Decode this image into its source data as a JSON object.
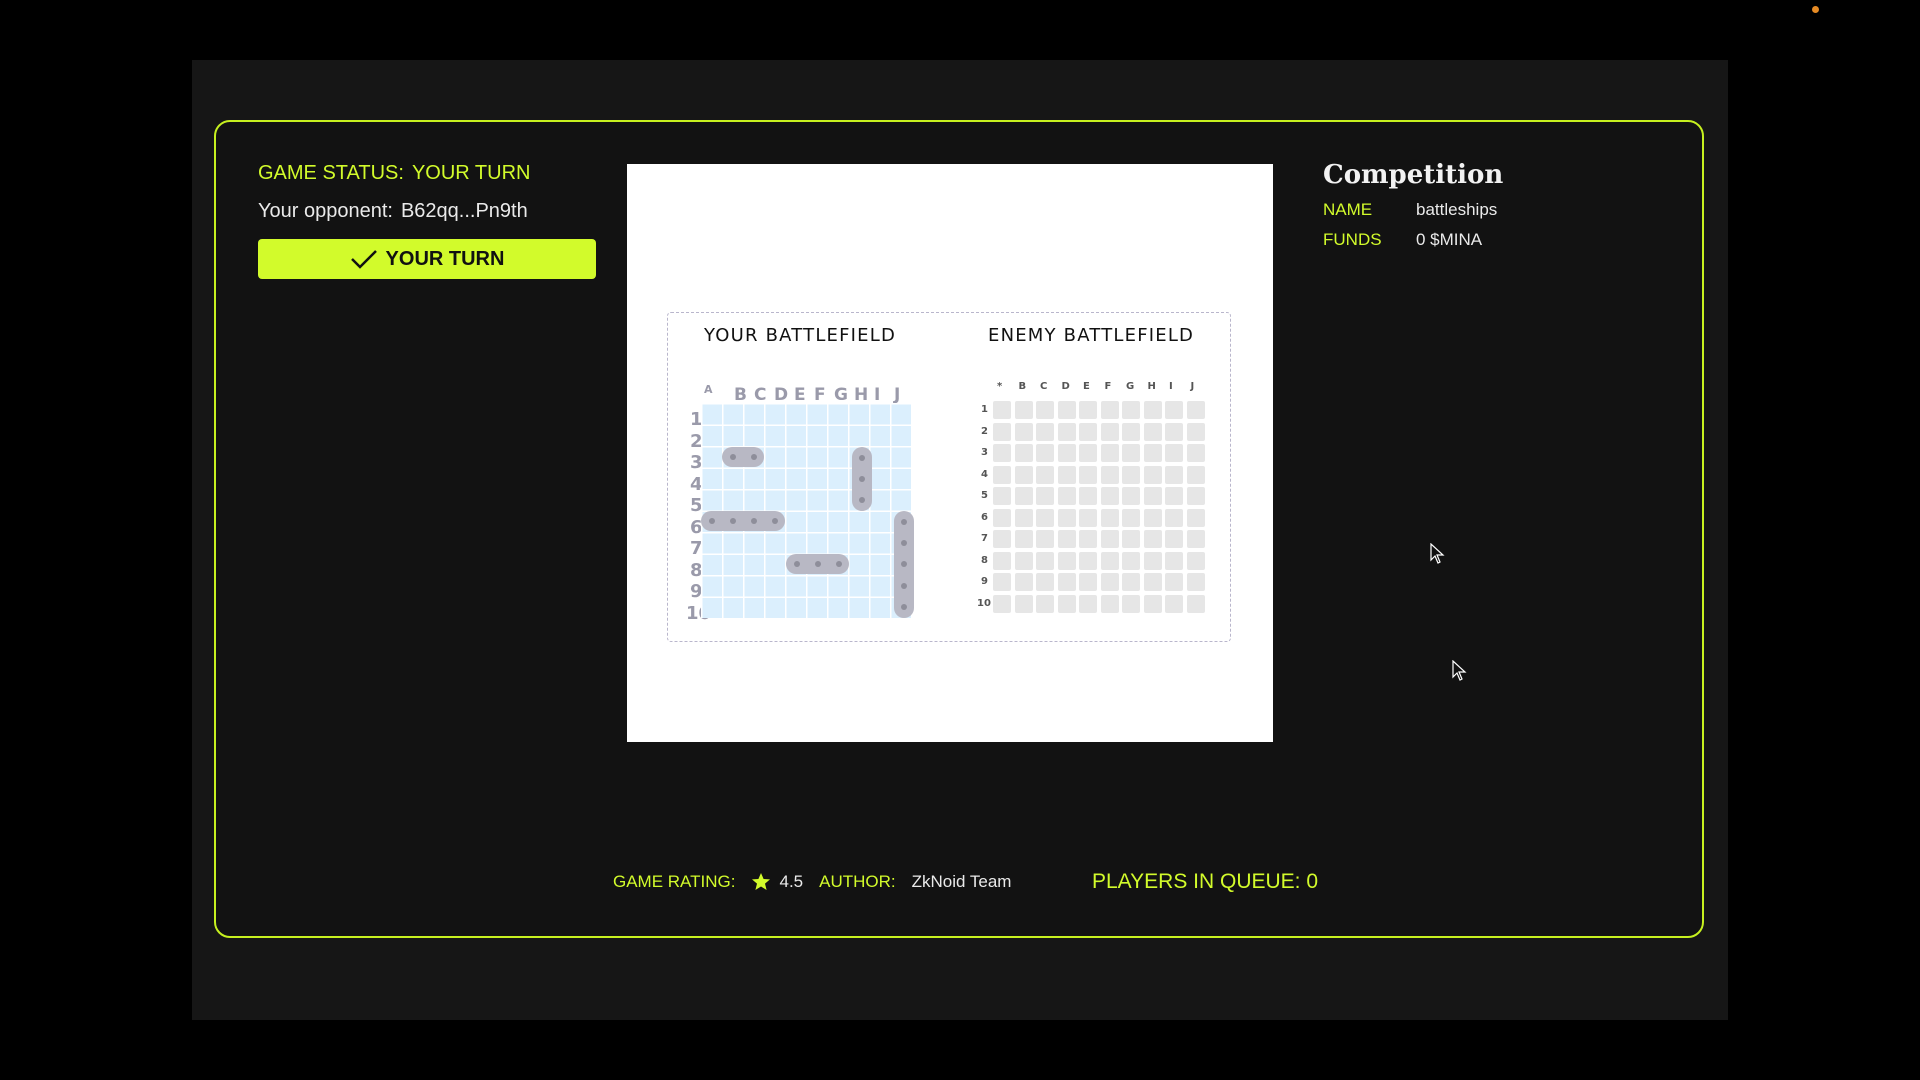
{
  "game_status": {
    "label": "GAME STATUS:",
    "value": "YOUR TURN"
  },
  "opponent": {
    "label": "Your opponent:",
    "value": "B62qq...Pn9th"
  },
  "turn_button": {
    "label": "YOUR TURN"
  },
  "board": {
    "own_title": "YOUR BATTLEFIELD",
    "enemy_title": "ENEMY BATTLEFIELD",
    "own_columns": [
      "A",
      "B",
      "C",
      "D",
      "E",
      "F",
      "G",
      "H",
      "I",
      "J"
    ],
    "enemy_columns": [
      "*",
      "B",
      "C",
      "D",
      "E",
      "F",
      "G",
      "H",
      "I",
      "J"
    ],
    "rows": [
      "1",
      "2",
      "3",
      "4",
      "5",
      "6",
      "7",
      "8",
      "9",
      "10"
    ]
  },
  "competition": {
    "title": "Competition",
    "name_label": "NAME",
    "name_value": "battleships",
    "funds_label": "FUNDS",
    "funds_value": "0 $MINA"
  },
  "footer": {
    "rating_label": "GAME RATING:",
    "rating_value": "4.5",
    "author_label": "AUTHOR:",
    "author_value": "ZkNoid Team",
    "queue_label": "PLAYERS IN QUEUE: 0"
  },
  "colors": {
    "accent": "#d2fb2b",
    "background": "#121212",
    "own_grid": "#dbeffd",
    "ship": "#b8b8c4",
    "enemy_cell": "#e6e6e6"
  }
}
